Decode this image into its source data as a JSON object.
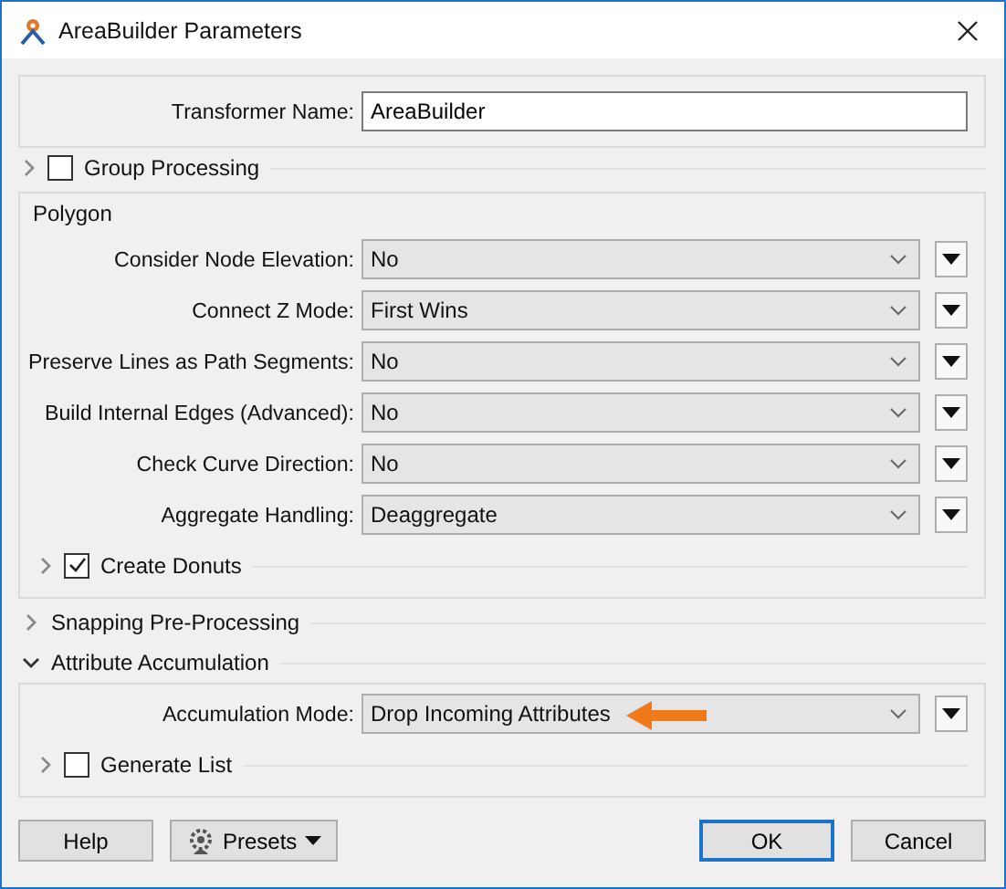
{
  "window": {
    "title": "AreaBuilder Parameters"
  },
  "transformer_name": {
    "label": "Transformer Name:",
    "value": "AreaBuilder"
  },
  "sections": [
    {
      "kind": "check",
      "label": "Group Processing",
      "expanded": false,
      "checked": false
    },
    {
      "kind": "group",
      "title": "Polygon",
      "params": [
        {
          "label": "Consider Node Elevation:",
          "value": "No",
          "arrow": false
        },
        {
          "label": "Connect Z Mode:",
          "value": "First Wins",
          "arrow": false
        },
        {
          "label": "Preserve Lines as Path Segments:",
          "value": "No",
          "arrow": false
        },
        {
          "label": "Build Internal Edges (Advanced):",
          "value": "No",
          "arrow": false
        },
        {
          "label": "Check Curve Direction:",
          "value": "No",
          "arrow": false
        },
        {
          "label": "Aggregate Handling:",
          "value": "Deaggregate",
          "arrow": false
        }
      ],
      "subsections": [
        {
          "label": "Create Donuts",
          "expanded": false,
          "checked": true
        }
      ]
    },
    {
      "kind": "section",
      "title": "Snapping Pre-Processing",
      "expanded": false
    },
    {
      "kind": "section",
      "title": "Attribute Accumulation",
      "expanded": true,
      "params": [
        {
          "label": "Accumulation Mode:",
          "value": "Drop Incoming Attributes",
          "arrow": true
        }
      ],
      "subsections": [
        {
          "label": "Generate List",
          "expanded": false,
          "checked": false
        }
      ]
    }
  ],
  "buttons_left": [
    {
      "label": "Help",
      "kind": "plain"
    },
    {
      "label": "Presets",
      "kind": "menu"
    }
  ],
  "buttons_right": [
    {
      "label": "OK",
      "kind": "default"
    },
    {
      "label": "Cancel",
      "kind": "plain"
    }
  ]
}
